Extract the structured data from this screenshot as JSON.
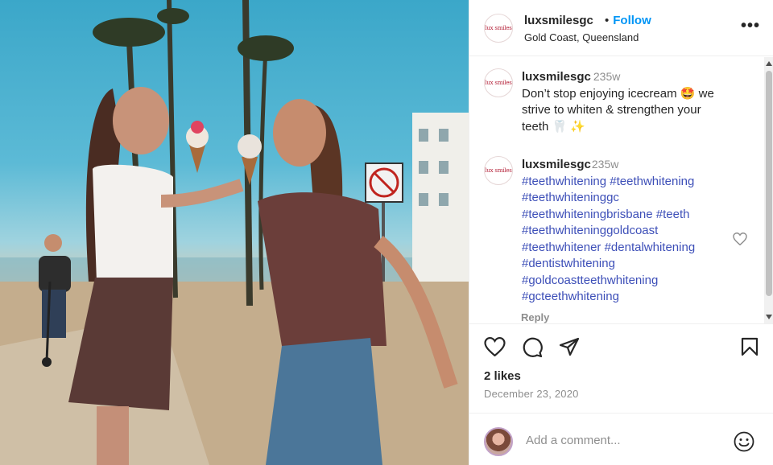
{
  "post": {
    "image_alt": "Two women eating ice cream on a beach boardwalk",
    "username": "luxsmilesgc",
    "avatar_text": "lux smiles",
    "follow_label": "Follow",
    "separator": "•",
    "location": "Gold Coast, Queensland",
    "more_icon": "more-options-icon"
  },
  "comments": [
    {
      "username": "luxsmilesgc",
      "time": "235w",
      "text": "Don’t stop enjoying icecream 🤩 we strive to whiten & strengthen your teeth 🦷 ✨"
    },
    {
      "username": "luxsmilesgc",
      "time": "235w",
      "hashtags": [
        "#teethwhitening",
        "#teethwhitening",
        "#teethwhiteninggc",
        "#teethwhiteningbrisbane",
        "#teeth",
        "#teethwhiteninggoldcoast",
        "#teethwhitener",
        "#dentalwhitening",
        "#dentistwhitening",
        "#goldcoastteethwhitening",
        "#gcteethwhitening"
      ],
      "reply_label": "Reply"
    }
  ],
  "actions": {
    "likes": "2 likes",
    "date": "December 23, 2020"
  },
  "add_comment": {
    "placeholder": "Add a comment..."
  },
  "colors": {
    "follow": "#0095f6",
    "hashtag": "#3d4fb8",
    "muted": "#8e8e8e",
    "text": "#262626"
  }
}
